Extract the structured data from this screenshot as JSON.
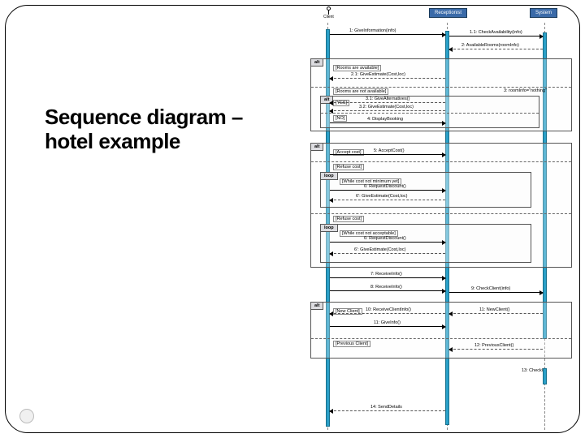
{
  "title_line1": "Sequence diagram –",
  "title_line2": "hotel example",
  "participants": {
    "client": "Client",
    "receptionist": "Receptionist",
    "system": "System"
  },
  "fragments": {
    "alt1": "alt",
    "alt2": "alt",
    "alt3": "alt",
    "alt4": "alt",
    "loop1": "loop",
    "loop2": "loop"
  },
  "guards": {
    "rooms_available": "[Rooms are available]",
    "rooms_not_available": "[Rooms are not available]",
    "yes": "[YES]",
    "no": "[NO]",
    "accept_cost": "[Accept cost]",
    "refuse_cost": "[Refuse cost]",
    "while_cost_not_min": "[While cost not minimum yet]",
    "refuse_cost2": "[Refuse cost]",
    "while_cost_unaccept": "[While cost not acceptable]",
    "new_client": "[New Client]",
    "previous_client": "[Previous Client]"
  },
  "messages": {
    "m1": "1: GiveInformation(info)",
    "m1_1": "1.1: CheckAvailability(info)",
    "m2": "2: AvailableRooms(roomInfo)",
    "m2_1": "2.1: GiveEstimate(Cost,loc)",
    "m3": "3: roomInfo=\"nothing\"",
    "m3_1": "3.1: GiveAlternatives()",
    "m3_2": "3.2: GiveEstimate(Cost,loc)",
    "m4": "4: DisplayBooking",
    "m5": "5: AcceptCost()",
    "m6": "6: RequestDiscount()",
    "m6_r": "6': GiveEstimate(Cost,loc)",
    "m6b": "6: RequestDiscount()",
    "m6b_r": "6': GiveEstimate(Cost,loc)",
    "m7": "7: ReceiveInfo()",
    "m8": "8: ReceiveInfo()",
    "m9": "9: CheckClient(info)",
    "m10": "10: ReceiveClientInfo()",
    "m11": "11: NewClient()",
    "m11b": "11: GiveInfo()",
    "m12": "12: PreviousClient()",
    "m13": "13: CheckIn",
    "m14": "14: SendDetails"
  }
}
